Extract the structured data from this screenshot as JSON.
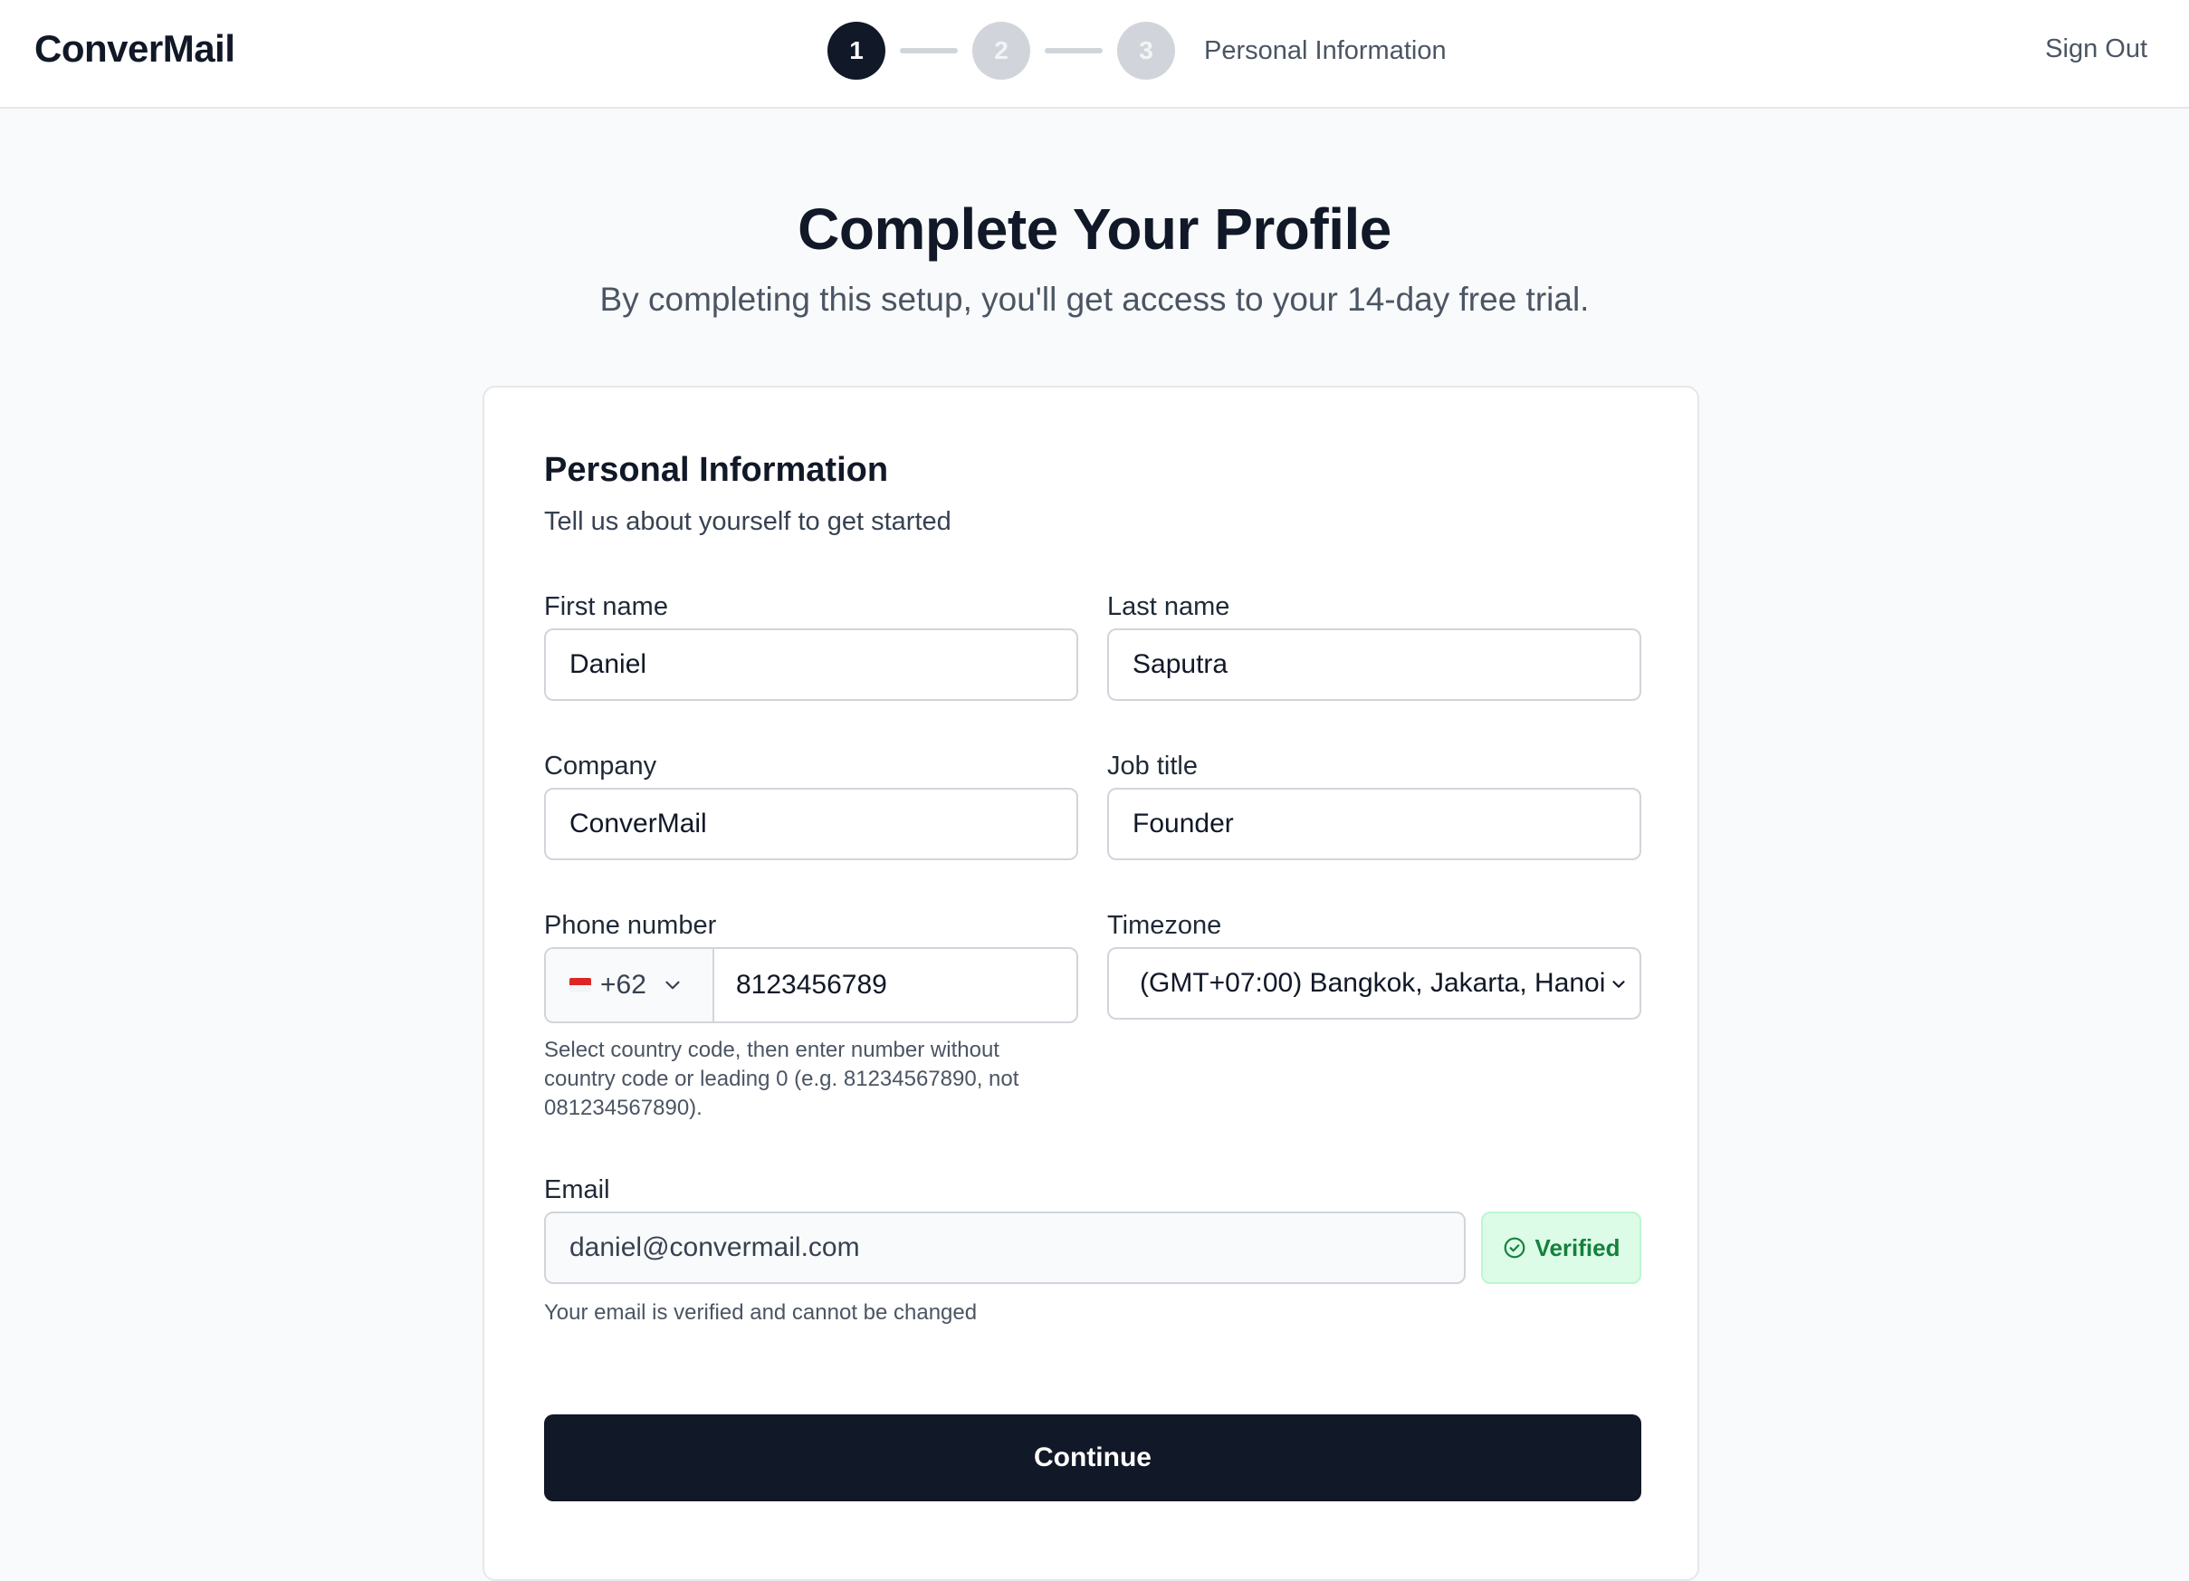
{
  "header": {
    "logo": "ConverMail",
    "steps": [
      "1",
      "2",
      "3"
    ],
    "current_step_label": "Personal Information",
    "sign_out": "Sign Out"
  },
  "hero": {
    "title": "Complete Your Profile",
    "subtitle": "By completing this setup, you'll get access to your 14-day free trial."
  },
  "form": {
    "title": "Personal Information",
    "subtitle": "Tell us about yourself to get started",
    "first_name": {
      "label": "First name",
      "value": "Daniel"
    },
    "last_name": {
      "label": "Last name",
      "value": "Saputra"
    },
    "company": {
      "label": "Company",
      "value": "ConverMail"
    },
    "job_title": {
      "label": "Job title",
      "value": "Founder"
    },
    "phone": {
      "label": "Phone number",
      "country_code": "+62",
      "value": "8123456789",
      "help_line1": "Select country code, then enter number without",
      "help_line2": "country code or leading 0 (e.g. 81234567890, not",
      "help_line3": "081234567890)."
    },
    "timezone": {
      "label": "Timezone",
      "value": "(GMT+07:00) Bangkok, Jakarta, Hanoi"
    },
    "email": {
      "label": "Email",
      "value": "daniel@convermail.com",
      "badge": "Verified",
      "help": "Your email is verified and cannot be changed"
    },
    "continue_label": "Continue"
  },
  "colors": {
    "primary": "#111827",
    "step_inactive": "#d1d5db",
    "verified_bg": "#dcfce7",
    "verified_text": "#15803d"
  },
  "icons": [
    "chevron-down-icon",
    "check-circle-icon",
    "flag-icon"
  ]
}
